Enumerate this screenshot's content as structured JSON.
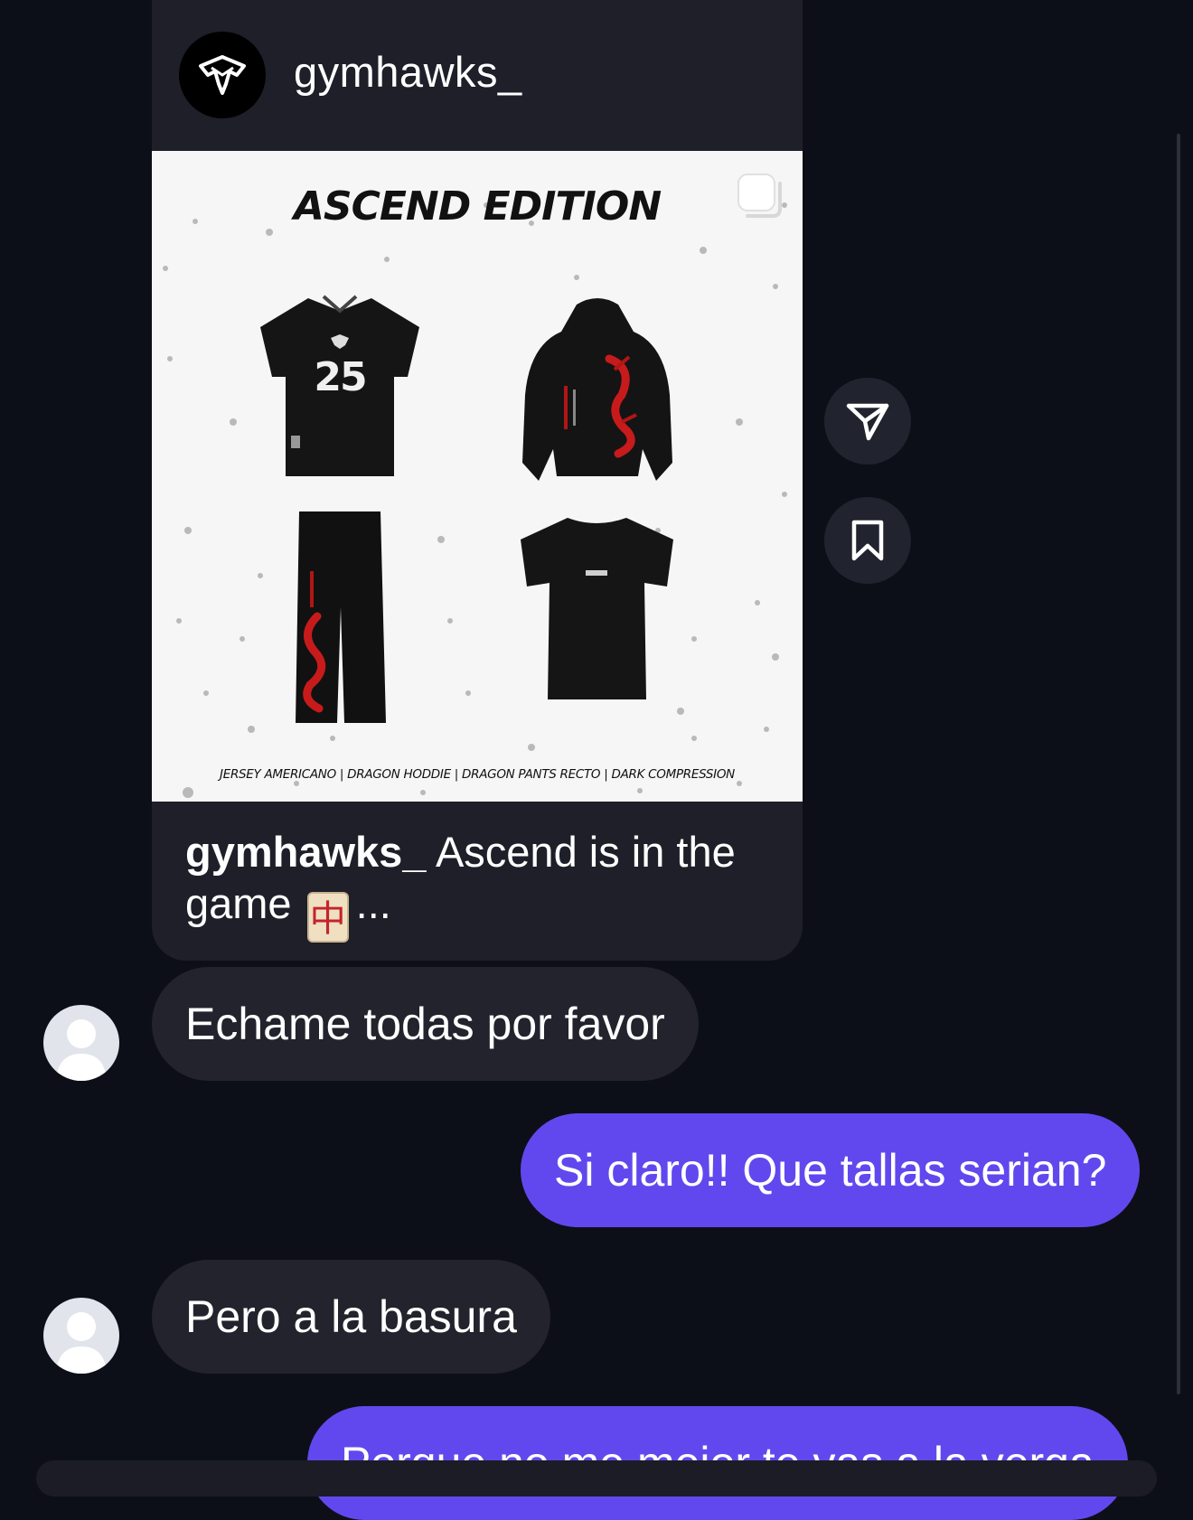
{
  "shared_post": {
    "username": "gymhawks_",
    "image": {
      "title": "ASCEND EDITION",
      "footer": "JERSEY AMERICANO | DRAGON HODDIE | DRAGON PANTS RECTO | DARK COMPRESSION",
      "jersey_number": "25"
    },
    "caption_user": "gymhawks_",
    "caption_text": "Ascend is in the game",
    "caption_emoji": "中",
    "caption_more": "..."
  },
  "messages": [
    {
      "direction": "in",
      "text": "Echame todas por favor"
    },
    {
      "direction": "out",
      "text": "Si claro!! Que tallas serian?"
    },
    {
      "direction": "in",
      "text": "Pero a la basura"
    },
    {
      "direction": "out",
      "text": "Porque no me mejor te vas a la verga"
    }
  ],
  "icons": {
    "share": "send-icon",
    "save": "bookmark-icon",
    "carousel": "multiple-posts-icon"
  },
  "colors": {
    "background": "#0d0f18",
    "incoming_bubble": "#22232d",
    "outgoing_bubble": "#6148ee"
  }
}
